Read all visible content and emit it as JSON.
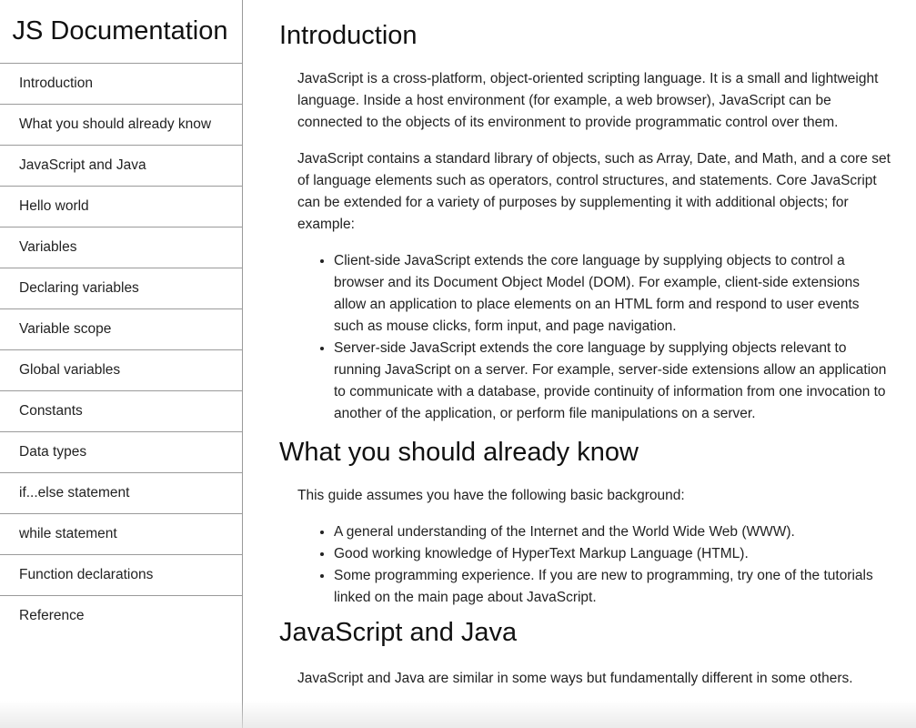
{
  "navbar": {
    "title": "JS Documentation",
    "items": [
      {
        "label": "Introduction"
      },
      {
        "label": "What you should already know"
      },
      {
        "label": "JavaScript and Java"
      },
      {
        "label": "Hello world"
      },
      {
        "label": "Variables"
      },
      {
        "label": "Declaring variables"
      },
      {
        "label": "Variable scope"
      },
      {
        "label": "Global variables"
      },
      {
        "label": "Constants"
      },
      {
        "label": "Data types"
      },
      {
        "label": "if...else statement"
      },
      {
        "label": "while statement"
      },
      {
        "label": "Function declarations"
      },
      {
        "label": "Reference"
      }
    ]
  },
  "main": {
    "introduction": {
      "heading": "Introduction",
      "p1": "JavaScript is a cross-platform, object-oriented scripting language. It is a small and lightweight language. Inside a host environment (for example, a web browser), JavaScript can be connected to the objects of its environment to provide programmatic control over them.",
      "p2": "JavaScript contains a standard library of objects, such as Array, Date, and Math, and a core set of language elements such as operators, control structures, and statements. Core JavaScript can be extended for a variety of purposes by supplementing it with additional objects; for example:",
      "bullets": [
        "Client-side JavaScript extends the core language by supplying objects to control a browser and its Document Object Model (DOM). For example, client-side extensions allow an application to place elements on an HTML form and respond to user events such as mouse clicks, form input, and page navigation.",
        "Server-side JavaScript extends the core language by supplying objects relevant to running JavaScript on a server. For example, server-side extensions allow an application to communicate with a database, provide continuity of information from one invocation to another of the application, or perform file manipulations on a server."
      ]
    },
    "already_know": {
      "heading": "What you should already know",
      "p1": "This guide assumes you have the following basic background:",
      "bullets": [
        "A general understanding of the Internet and the World Wide Web (WWW).",
        "Good working knowledge of HyperText Markup Language (HTML).",
        "Some programming experience. If you are new to programming, try one of the tutorials linked on the main page about JavaScript."
      ]
    },
    "javascript_and_java": {
      "heading": "JavaScript and Java",
      "p1": "JavaScript and Java are similar in some ways but fundamentally different in some others."
    }
  }
}
